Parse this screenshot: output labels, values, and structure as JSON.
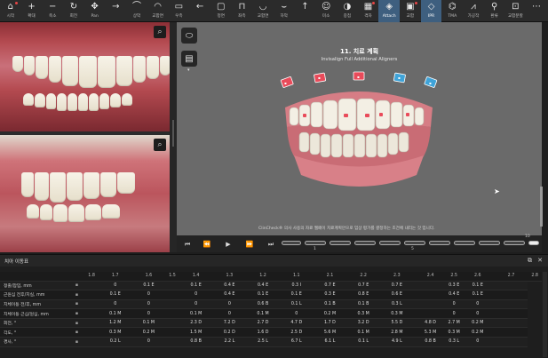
{
  "toolbar": {
    "items": [
      {
        "label": "시작",
        "icon": "home-icon",
        "glyph": "⌂"
      },
      {
        "label": "확대",
        "icon": "zoom-in-icon",
        "glyph": "+"
      },
      {
        "label": "축소",
        "icon": "zoom-out-icon",
        "glyph": "−"
      },
      {
        "label": "회전",
        "icon": "rotate-icon",
        "glyph": "↻"
      },
      {
        "label": "Pan",
        "icon": "pan-icon",
        "glyph": "✥"
      },
      {
        "label": "",
        "icon": "arrow-right-icon",
        "glyph": "→"
      },
      {
        "label": "상악",
        "icon": "upper-arch-icon",
        "glyph": "⌒"
      },
      {
        "label": "교합면",
        "icon": "occlusal-icon",
        "glyph": "◠"
      },
      {
        "label": "우측",
        "icon": "right-view-icon",
        "glyph": "▭"
      },
      {
        "label": "",
        "icon": "arrow-left-icon",
        "glyph": "←"
      },
      {
        "label": "정면",
        "icon": "front-view-icon",
        "glyph": "▢"
      },
      {
        "label": "좌측",
        "icon": "left-view-icon",
        "glyph": "⊓"
      },
      {
        "label": "교합면",
        "icon": "occlusal-lower-icon",
        "glyph": "◡"
      },
      {
        "label": "하악",
        "icon": "lower-arch-icon",
        "glyph": "⌣"
      },
      {
        "label": "",
        "icon": "arrow-up-icon",
        "glyph": "↑"
      },
      {
        "label": "미소",
        "icon": "smile-icon",
        "glyph": "☺"
      },
      {
        "label": "중첩",
        "icon": "overlay-icon",
        "glyph": "◑"
      },
      {
        "label": "격자",
        "icon": "grid-icon",
        "glyph": "▦"
      },
      {
        "label": "Attach",
        "icon": "attachment-icon",
        "glyph": "◈"
      },
      {
        "label": "교합",
        "icon": "occlusion-icon",
        "glyph": "▣"
      },
      {
        "label": "IPR",
        "icon": "ipr-icon",
        "glyph": "◇"
      },
      {
        "label": "TMA",
        "icon": "tma-icon",
        "glyph": "⌬"
      },
      {
        "label": "가공작",
        "icon": "pontic-icon",
        "glyph": "⩘"
      },
      {
        "label": "환류",
        "icon": "reflux-icon",
        "glyph": "⚲"
      },
      {
        "label": "교합분할",
        "icon": "bite-split-icon",
        "glyph": "⊡"
      },
      {
        "label": "",
        "icon": "more-icon",
        "glyph": "⋯"
      }
    ],
    "active": [
      18,
      20
    ],
    "alerts": [
      0,
      17,
      19
    ]
  },
  "viewer": {
    "title": "11. 치료 계획",
    "subtitle": "Invisalign Full Additional Aligners",
    "clincheck_note": "ClinCheck® 의사 사용의 자료 웹페이 치료계획안으로 임상 평가를 결정하는 조건에 내리는 것 입니다."
  },
  "timeline": {
    "labels": [
      "1",
      "5",
      "10"
    ]
  },
  "movement_panel": {
    "title": "치아 이동표",
    "columns": [
      "",
      "",
      "1.8",
      "1.7",
      "1.6",
      "1.5",
      "1.4",
      "1.3",
      "1.2",
      "1.1",
      "2.1",
      "2.2",
      "2.3",
      "2.4",
      "2.5",
      "2.6",
      "2.7",
      "2.8"
    ],
    "rows": [
      {
        "label": "정출/압입, mm",
        "icon": "▪",
        "values": [
          "",
          "0",
          "0.1 E",
          "",
          "0.1 E",
          "0.4 E",
          "0.4 E",
          "0.3 I",
          "0.7 E",
          "0.7 E",
          "0.7 E",
          "",
          "0.3 E",
          "0.1 E",
          ""
        ]
      },
      {
        "label": "근원심 전후/치실, mm",
        "icon": "▪",
        "values": [
          "",
          "0.1 E",
          "0",
          "",
          "0",
          "0.4 E",
          "0.1 E",
          "0.1 E",
          "0.3 E",
          "0.8 E",
          "0.6 E",
          "",
          "0.4 E",
          "0.1 E",
          ""
        ]
      },
      {
        "label": "치체이동 전/후, mm",
        "icon": "▪",
        "values": [
          "",
          "0",
          "0",
          "",
          "0",
          "0",
          "0.6 B",
          "0.1 L",
          "0.1 B",
          "0.1 B",
          "0.3 L",
          "",
          "0",
          "0",
          ""
        ]
      },
      {
        "label": "치체이동 근심/원심, mm",
        "icon": "▪",
        "values": [
          "",
          "0.1 M",
          "0",
          "",
          "0.1 M",
          "0",
          "0.1 M",
          "0",
          "0.2 M",
          "0.3 M",
          "0.3 M",
          "",
          "0",
          "0",
          ""
        ]
      },
      {
        "label": "회전, °",
        "icon": "▪",
        "values": [
          "",
          "1.2 M",
          "0.1 M",
          "",
          "2.3 D",
          "7.2 D",
          "2.7 D",
          "4.7 D",
          "1.7 D",
          "3.2 D",
          "5.5 D",
          "4.8 D",
          "2.7 M",
          "0.2 M",
          ""
        ]
      },
      {
        "label": "각도, °",
        "icon": "▪",
        "values": [
          "",
          "0.3 M",
          "0.2 M",
          "",
          "1.5 M",
          "0.2 D",
          "1.6 D",
          "2.5 D",
          "5.6 M",
          "0.1 M",
          "2.8 M",
          "5.3 M",
          "0.3 M",
          "0.2 M",
          ""
        ]
      },
      {
        "label": "경사, °",
        "icon": "▪",
        "values": [
          "",
          "0.2 L",
          "0",
          "",
          "0.8 B",
          "2.2 L",
          "2.5 L",
          "6.7 L",
          "6.1 L",
          "0.1 L",
          "4.9 L",
          "0.8 B",
          "0.3 L",
          "0",
          ""
        ]
      }
    ]
  },
  "colors": {
    "active_tool": "#3e5f7f",
    "alert_dot": "#e64545",
    "viewer_bg": "#6a6a6a",
    "gum": "#d2777f",
    "ipr_marker": "#e94b5a",
    "ipr_marker_blue": "#3fa3d8"
  }
}
